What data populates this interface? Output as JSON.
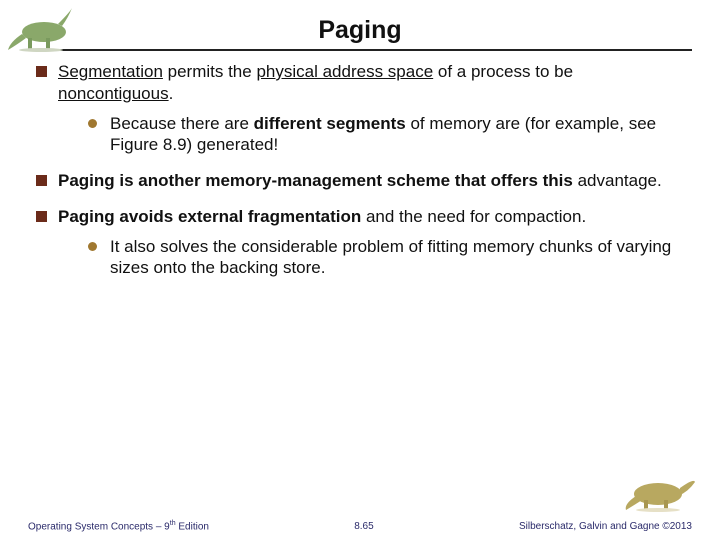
{
  "title": "Paging",
  "bullets": {
    "b1_pre": "Segmentation",
    "b1_mid1": " permits the ",
    "b1_mid2": "physical address space",
    "b1_mid3": " of a process to be ",
    "b1_end": "noncontiguous",
    "b1_period": ".",
    "b1a_pre": "Because there are ",
    "b1a_bold": "different segments",
    "b1a_post": " of memory are (for example, see Figure 8.9) generated!",
    "b2_bold": "Paging is another memory-management scheme that offers this",
    "b2_post": " advantage.",
    "b3_bold": "Paging avoids external fragmentation",
    "b3_post": " and the need for compaction.",
    "b3a": "It also solves the considerable problem of fitting memory chunks of varying sizes onto the backing store."
  },
  "footer": {
    "left_pre": "Operating System Concepts – 9",
    "left_sup": "th",
    "left_post": " Edition",
    "center": "8.65",
    "right": "Silberschatz, Galvin and Gagne ©2013"
  }
}
